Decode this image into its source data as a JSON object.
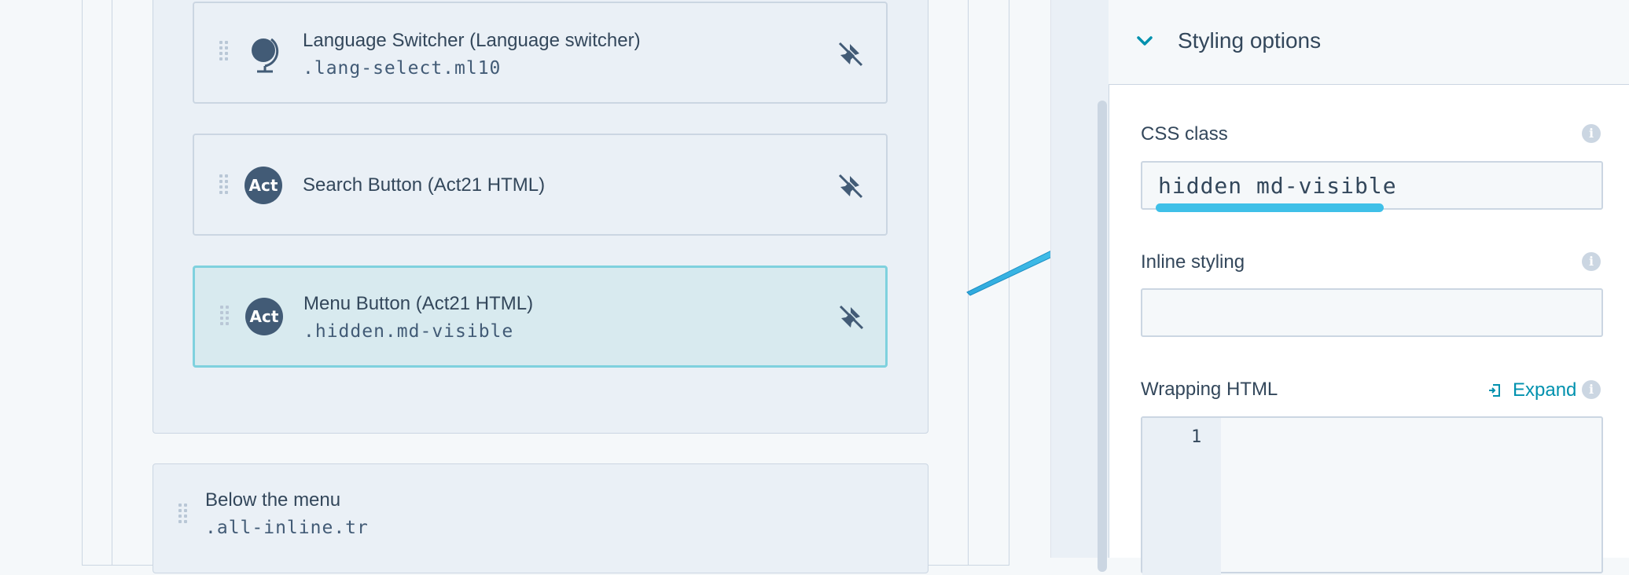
{
  "modules": [
    {
      "title": "Language Switcher (Language switcher)",
      "css_class": ".lang-select.ml10",
      "icon": "globe-icon"
    },
    {
      "title": "Search Button (Act21 HTML)",
      "css_class": "",
      "icon": "act21-icon",
      "icon_text": "Aсt"
    },
    {
      "title": "Menu Button (Act21 HTML)",
      "css_class": ".hidden.md-visible",
      "icon": "act21-icon",
      "icon_text": "Aсt",
      "selected": true
    }
  ],
  "below_menu": {
    "title": "Below the menu",
    "css_class": ".all-inline.tr"
  },
  "panel": {
    "section_title": "Styling options",
    "css_class_label": "CSS class",
    "css_class_value": "hidden md-visible",
    "inline_styling_label": "Inline styling",
    "inline_styling_value": "",
    "wrapping_html_label": "Wrapping HTML",
    "expand_label": "Expand",
    "code_line_number": "1"
  },
  "colors": {
    "accent": "#0091ae",
    "highlight": "#3fc0e8",
    "selected_border": "#7fd1de",
    "icon_bg": "#425b76"
  }
}
